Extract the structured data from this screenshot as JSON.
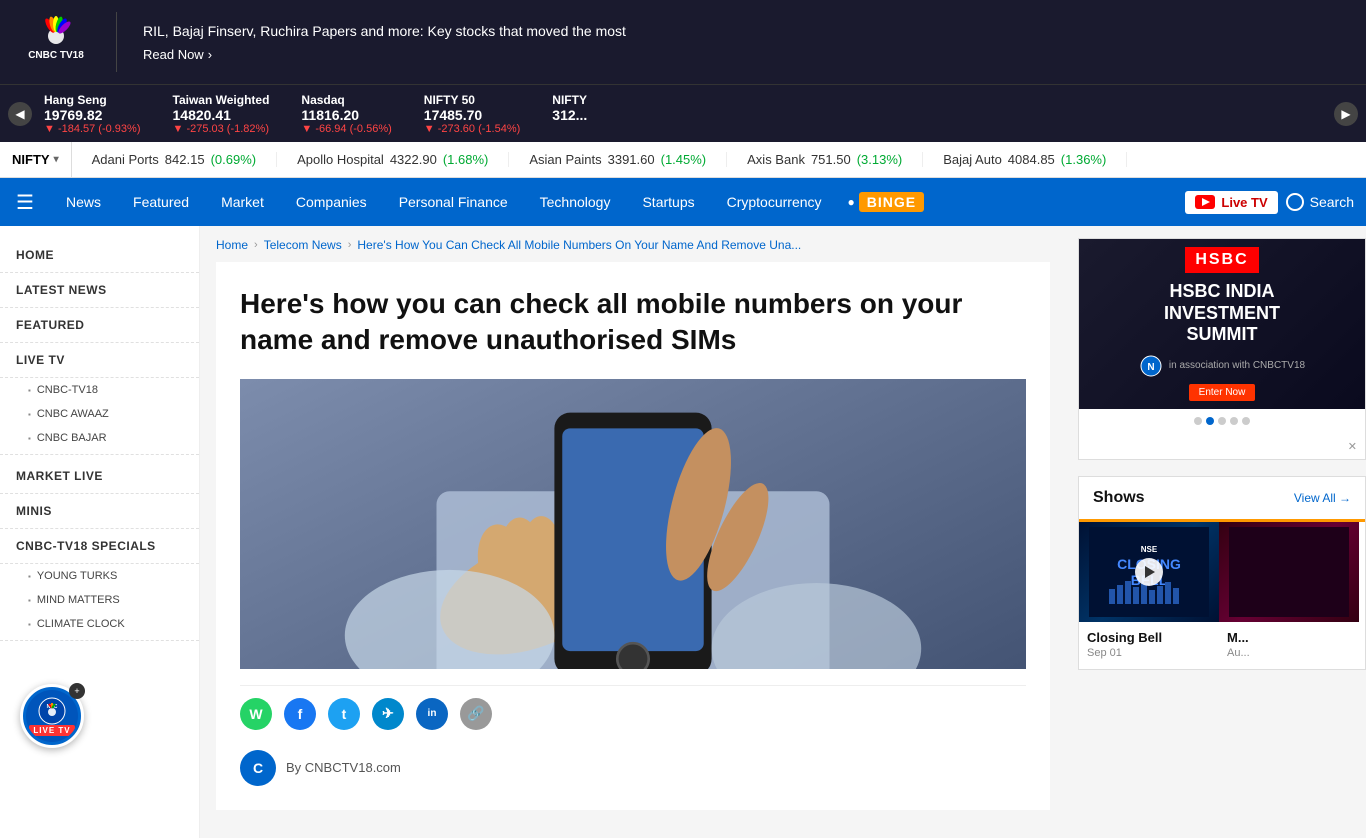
{
  "breakingBar": {
    "headline": "RIL, Bajaj Finserv, Ruchira Papers and more: Key stocks that moved the most",
    "readNowLabel": "Read Now"
  },
  "ticker": {
    "prevLabel": "◀",
    "nextLabel": "▶",
    "items": [
      {
        "name": "Hang Seng",
        "value": "19769.82",
        "change": "-184.57",
        "changePct": "(-0.93%)",
        "direction": "down"
      },
      {
        "name": "Taiwan Weighted",
        "value": "14820.41",
        "change": "-275.03",
        "changePct": "(-1.82%)",
        "direction": "down"
      },
      {
        "name": "Nasdaq",
        "value": "11816.20",
        "change": "-66.94",
        "changePct": "(-0.56%)",
        "direction": "down"
      },
      {
        "name": "NIFTY 50",
        "value": "17485.70",
        "change": "-273.60",
        "changePct": "(-1.54%)",
        "direction": "down"
      },
      {
        "name": "NIFTY",
        "value": "312...",
        "change": "",
        "changePct": "",
        "direction": "down"
      }
    ]
  },
  "stockBar": {
    "niftyLabel": "NIFTY",
    "stocks": [
      {
        "name": "Adani Ports",
        "price": "842.15",
        "change": "(0.69%)",
        "direction": "positive"
      },
      {
        "name": "Apollo Hospital",
        "price": "4322.90",
        "change": "(1.68%)",
        "direction": "positive"
      },
      {
        "name": "Asian Paints",
        "price": "3391.60",
        "change": "(1.45%)",
        "direction": "positive"
      },
      {
        "name": "Axis Bank",
        "price": "751.50",
        "change": "(3.13%)",
        "direction": "positive"
      },
      {
        "name": "Bajaj Auto",
        "price": "4084.85",
        "change": "(1.36%)",
        "direction": "positive"
      }
    ]
  },
  "nav": {
    "items": [
      {
        "label": "News",
        "id": "news"
      },
      {
        "label": "Featured",
        "id": "featured"
      },
      {
        "label": "Market",
        "id": "market"
      },
      {
        "label": "Companies",
        "id": "companies"
      },
      {
        "label": "Personal Finance",
        "id": "personal-finance"
      },
      {
        "label": "Technology",
        "id": "technology"
      },
      {
        "label": "Startups",
        "id": "startups"
      },
      {
        "label": "Cryptocurrency",
        "id": "cryptocurrency"
      }
    ],
    "bingeLabel": "BINGE",
    "liveTvLabel": "Live TV",
    "searchLabel": "Search"
  },
  "sidebar": {
    "sections": [
      {
        "label": "HOME",
        "id": "home"
      },
      {
        "label": "LATEST NEWS",
        "id": "latest-news"
      },
      {
        "label": "FEATURED",
        "id": "featured"
      },
      {
        "label": "LIVE TV",
        "id": "live-tv",
        "children": [
          {
            "label": "CNBC-TV18",
            "id": "cnbc-tv18"
          },
          {
            "label": "CNBC AWAAZ",
            "id": "cnbc-awaaz"
          },
          {
            "label": "CNBC BAJAR",
            "id": "cnbc-bajar"
          }
        ]
      },
      {
        "label": "MARKET LIVE",
        "id": "market-live"
      },
      {
        "label": "MINIS",
        "id": "minis"
      },
      {
        "label": "CNBC-TV18 SPECIALS",
        "id": "cnbc-tv18-specials",
        "children": [
          {
            "label": "YOUNG TURKS",
            "id": "young-turks"
          },
          {
            "label": "MIND MATTERS",
            "id": "mind-matters"
          },
          {
            "label": "CLIMATE CLOCK",
            "id": "climate-clock"
          }
        ]
      }
    ]
  },
  "breadcrumb": {
    "home": "Home",
    "telecomNews": "Telecom News",
    "current": "Here's How You Can Check All Mobile Numbers On Your Name And Remove Una..."
  },
  "article": {
    "title": "Here's how you can check all mobile numbers on your name and remove unauthorised SIMs",
    "authorLine": "By CNBCTV18.com"
  },
  "social": {
    "icons": [
      {
        "id": "whatsapp",
        "symbol": "W"
      },
      {
        "id": "facebook",
        "symbol": "f"
      },
      {
        "id": "twitter",
        "symbol": "t"
      },
      {
        "id": "telegram",
        "symbol": "T"
      },
      {
        "id": "linkedin",
        "symbol": "in"
      },
      {
        "id": "link",
        "symbol": "🔗"
      }
    ]
  },
  "rightSidebar": {
    "ad": {
      "hsbcLabel": "HSBC",
      "summitTitle": "HSBC INDIA\nINVESTMENT\nSUMMIT"
    },
    "shows": {
      "title": "Shows",
      "viewAllLabel": "View All →",
      "items": [
        {
          "name": "Closing Bell",
          "date": "Sep 01",
          "id": "closing-bell"
        },
        {
          "name": "M...",
          "date": "Au...",
          "id": "show-2"
        }
      ]
    }
  },
  "liveTv": {
    "label": "LIVE TV",
    "closeLabel": "✕"
  }
}
